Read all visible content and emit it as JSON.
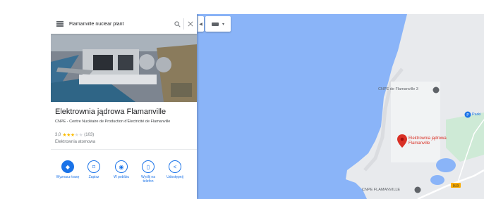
{
  "search": {
    "query": "Flamanville nuclear plant"
  },
  "icons": {
    "menu": "menu-icon",
    "search": "search-icon",
    "close": "close-icon",
    "collapse": "chevron-left-icon",
    "layers": "keyboard-icon",
    "dropdown": "caret-down-icon"
  },
  "place": {
    "title": "Elektrownia jądrowa Flamanville",
    "subtitle": "CNPE - Centre Nucléaire de Production d'Électricité de Flamanville",
    "rating": "3,0",
    "stars": 3,
    "reviews": "(103)",
    "category": "Elektrownia atomowa"
  },
  "actions": [
    {
      "label": "Wyznacz trasę",
      "icon": "directions-icon"
    },
    {
      "label": "Zapisz",
      "icon": "bookmark-icon"
    },
    {
      "label": "W pobliżu",
      "icon": "nearby-icon"
    },
    {
      "label": "Wyślij na telefon",
      "icon": "send-to-phone-icon"
    },
    {
      "label": "Udostępnij",
      "icon": "share-icon"
    }
  ],
  "map": {
    "labels": {
      "cnpe3": "CNPE de Flamanville 3",
      "parking": "Parki",
      "cnpe": "CNPE FLAMANVILLE",
      "pin": "Elektrownia jądrowa Flamanville",
      "road": "D23"
    },
    "colors": {
      "water": "#8ab4f8",
      "land": "#e8eaed",
      "pin": "#d93025"
    }
  }
}
